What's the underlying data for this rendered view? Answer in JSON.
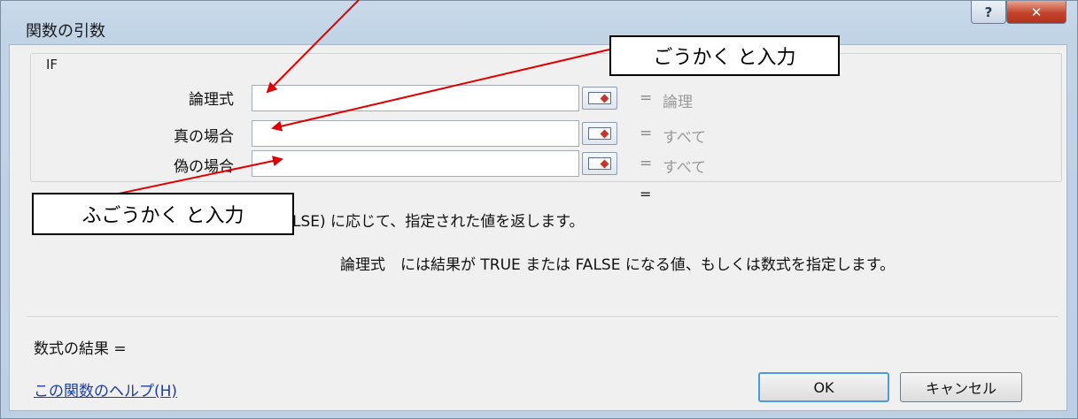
{
  "window": {
    "title": "関数の引数",
    "help_glyph": "?",
    "close_glyph": "✕"
  },
  "function_group": {
    "name": "IF"
  },
  "arguments": [
    {
      "label": "論理式",
      "value": "",
      "hint": "論理"
    },
    {
      "label": "真の場合",
      "value": "",
      "hint": "すべて"
    },
    {
      "label": "偽の場合",
      "value": "",
      "hint": "すべて"
    }
  ],
  "eq_sign": "=",
  "result_eq": "=",
  "description": {
    "main": "LSE) に応じて、指定された値を返します。",
    "detail": "論理式　には結果が TRUE または FALSE になる値、もしくは数式を指定します。"
  },
  "formula_result_label": "数式の結果 =",
  "help_link": "この関数のヘルプ(H)",
  "buttons": {
    "ok": "OK",
    "cancel": "キャンセル"
  },
  "annotations": {
    "callout_true": "ごうかく と入力",
    "callout_false": "ふごうかく と入力"
  },
  "colors": {
    "arrow": "#e00000",
    "link": "#1b3ea8",
    "ok_border": "#4a9be0"
  }
}
